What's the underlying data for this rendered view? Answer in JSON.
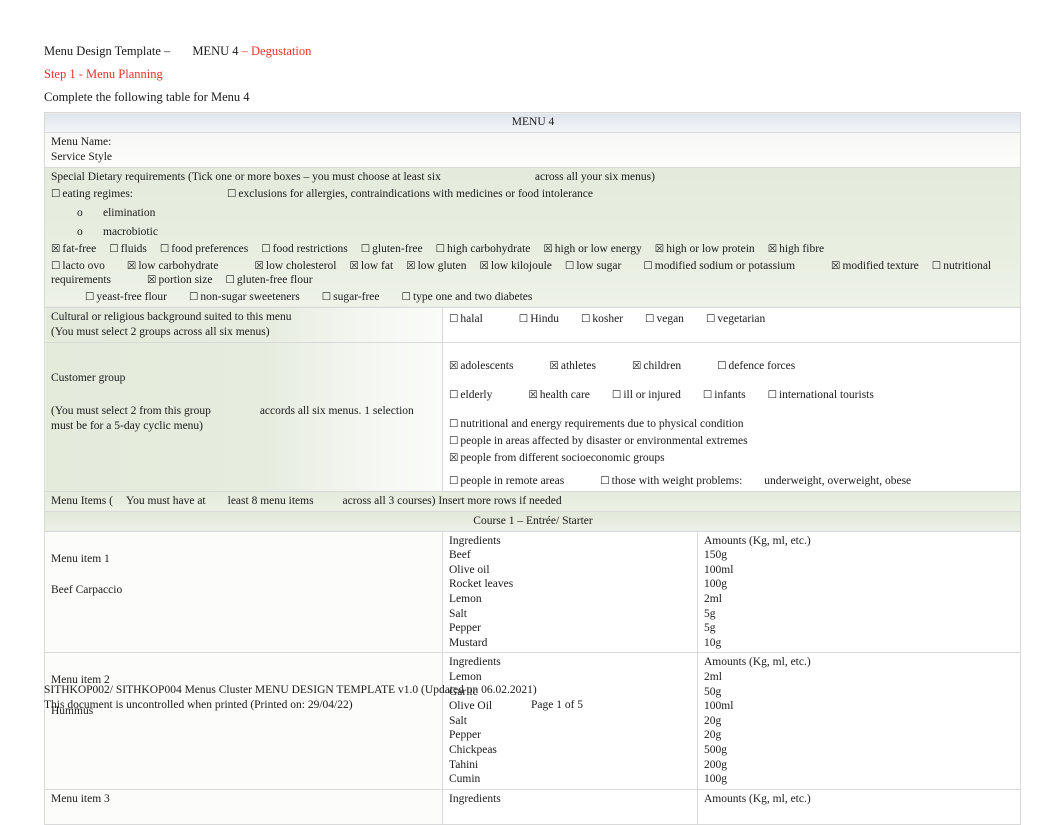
{
  "header": {
    "title_prefix": "Menu Design Template –",
    "title_menu": "MENU 4",
    "title_suffix": "– Degustation",
    "step": "Step 1 - Menu Planning",
    "instruction": "Complete the following table for Menu 4"
  },
  "table": {
    "menu_header": "MENU 4",
    "menu_name_label": "Menu Name:",
    "service_style_label": "Service Style",
    "special_dietary": {
      "text_a": "Special Dietary requirements (Tick one or more boxes – you must choose at least six",
      "text_b": "across all your six menus)",
      "eating_regimes": "eating regimes:",
      "exclusions": "exclusions for allergies, contraindications with medicines or food intolerance",
      "sub_items": [
        "elimination",
        "macrobiotic"
      ],
      "options_row1": [
        {
          "label": "fat-free",
          "checked": true
        },
        {
          "label": "fluids",
          "checked": false
        },
        {
          "label": "food preferences",
          "checked": false
        },
        {
          "label": "food restrictions",
          "checked": false
        },
        {
          "label": "gluten-free",
          "checked": false
        },
        {
          "label": "high carbohydrate",
          "checked": false
        },
        {
          "label": "high or low energy",
          "checked": true
        },
        {
          "label": "high or low protein",
          "checked": true
        },
        {
          "label": "high fibre",
          "checked": true
        }
      ],
      "options_row2": [
        {
          "label": "lacto ovo",
          "checked": false
        },
        {
          "label": "low carbohydrate",
          "checked": true
        },
        {
          "label": "low cholesterol",
          "checked": true
        },
        {
          "label": "low fat",
          "checked": true
        },
        {
          "label": "low gluten",
          "checked": true
        },
        {
          "label": "low kilojoule",
          "checked": true
        },
        {
          "label": "low sugar",
          "checked": false
        },
        {
          "label": "modified sodium or potassium",
          "checked": false
        },
        {
          "label": "modified texture",
          "checked": true
        },
        {
          "label": "nutritional requirements",
          "checked": false
        },
        {
          "label": "portion size",
          "checked": true
        },
        {
          "label": "gluten-free flour",
          "checked": false
        }
      ],
      "options_row3": [
        {
          "label": "yeast-free flour",
          "checked": false
        },
        {
          "label": "non-sugar sweeteners",
          "checked": false
        },
        {
          "label": "sugar-free",
          "checked": false
        },
        {
          "label": "type one and two diabetes",
          "checked": false
        }
      ]
    },
    "cultural": {
      "label_a": "Cultural or religious background suited to this menu",
      "label_b": "(You must select 2 groups across all six menus)",
      "options": [
        {
          "label": "halal",
          "checked": false
        },
        {
          "label": "Hindu",
          "checked": false
        },
        {
          "label": "kosher",
          "checked": false
        },
        {
          "label": "vegan",
          "checked": false
        },
        {
          "label": "vegetarian",
          "checked": false
        }
      ]
    },
    "customer_group": {
      "label": "Customer group",
      "note_a": "(You must select 2 from this group",
      "note_b": "accords all six menus. 1 selection",
      "note_c": "must be for a 5-day cyclic menu)",
      "row1": [
        {
          "label": "adolescents",
          "checked": true
        },
        {
          "label": "athletes",
          "checked": true
        },
        {
          "label": "children",
          "checked": true
        },
        {
          "label": "defence forces",
          "checked": false
        }
      ],
      "row2": [
        {
          "label": "elderly",
          "checked": false
        },
        {
          "label": "health care",
          "checked": true
        },
        {
          "label": "ill or injured",
          "checked": false
        },
        {
          "label": "infants",
          "checked": false
        },
        {
          "label": "international tourists",
          "checked": false
        }
      ],
      "row3": [
        {
          "label": "nutritional and energy requirements due to physical condition",
          "checked": false
        },
        {
          "label": "people in areas affected by disaster or environmental extremes",
          "checked": false
        },
        {
          "label": "people from different socioeconomic groups",
          "checked": true
        }
      ],
      "row4": [
        {
          "label": "people in remote areas",
          "checked": false
        },
        {
          "label": "those with weight problems:",
          "checked": false
        }
      ],
      "weight_detail": "underweight, overweight, obese"
    },
    "menu_items_header": {
      "part_a": "Menu Items (",
      "part_b": "You must have at",
      "part_c": "least 8 menu items",
      "part_d": "across all 3 courses) Insert more rows if needed"
    },
    "course_header": "Course 1 – Entrée/ Starter",
    "ingredients_header": "Ingredients",
    "amounts_header": "Amounts (Kg, ml, etc.)",
    "items": [
      {
        "item_label": "Menu item 1",
        "item_name": "Beef Carpaccio",
        "ingredients": [
          "Beef",
          "Olive oil",
          "Rocket leaves",
          "Lemon",
          "Salt",
          "Pepper",
          "Mustard"
        ],
        "amounts": [
          "150g",
          "100ml",
          "100g",
          "2ml",
          "5g",
          "5g",
          "10g"
        ]
      },
      {
        "item_label": "Menu item 2",
        "item_name": "Hummus",
        "ingredients": [
          "Lemon",
          "Garlic",
          "Olive Oil",
          "Salt",
          "Pepper",
          "Chickpeas",
          "Tahini",
          "Cumin"
        ],
        "amounts": [
          "2ml",
          "50g",
          "100ml",
          "20g",
          "20g",
          "500g",
          "200g",
          "100g"
        ]
      },
      {
        "item_label": "Menu item 3",
        "item_name": "",
        "ingredients": [],
        "amounts": []
      }
    ]
  },
  "footer": {
    "line1": "SITHKOP002/ SITHKOP004 Menus Cluster MENU DESIGN TEMPLATE v1.0 (Updated on 06.02.2021)",
    "line2": "This document is uncontrolled when printed (Printed on: 29/04/22)",
    "page": "Page 1 of 5"
  },
  "glyphs": {
    "checked": "☒",
    "unchecked": "☐",
    "bullet_o": "o"
  },
  "colors": {
    "red_accent": "#e8342a",
    "header_blue": "#dfe4ec",
    "shade_green": "#e5ebdc"
  }
}
